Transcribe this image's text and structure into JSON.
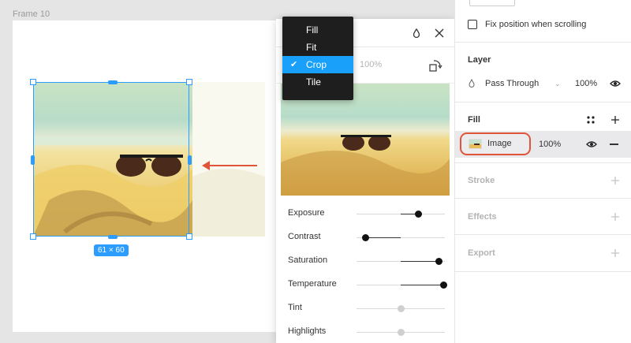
{
  "canvas": {
    "frame_label": "Frame 10",
    "size_badge": "61 × 60"
  },
  "image_editor": {
    "percent": "100%",
    "scale_menu": {
      "items": [
        {
          "label": "Fill",
          "selected": false
        },
        {
          "label": "Fit",
          "selected": false
        },
        {
          "label": "Crop",
          "selected": true
        },
        {
          "label": "Tile",
          "selected": false
        }
      ],
      "check_glyph": "✔"
    },
    "adjustments": [
      {
        "label": "Exposure",
        "value": 0.7,
        "active": true
      },
      {
        "label": "Contrast",
        "value": 0.1,
        "active": true
      },
      {
        "label": "Saturation",
        "value": 0.93,
        "active": true
      },
      {
        "label": "Temperature",
        "value": 0.99,
        "active": true
      },
      {
        "label": "Tint",
        "value": 0.5,
        "active": false
      },
      {
        "label": "Highlights",
        "value": 0.5,
        "active": false
      }
    ]
  },
  "properties": {
    "fix_position_label": "Fix position when scrolling",
    "layer": {
      "title": "Layer",
      "blend_mode": "Pass Through",
      "opacity": "100%"
    },
    "fill": {
      "title": "Fill",
      "type_label": "Image",
      "opacity": "100%"
    },
    "stroke": {
      "title": "Stroke"
    },
    "effects": {
      "title": "Effects"
    },
    "export": {
      "title": "Export"
    }
  },
  "colors": {
    "accent": "#18a0fb",
    "selection": "#2d9cff",
    "highlight_ring": "#e0553a"
  }
}
